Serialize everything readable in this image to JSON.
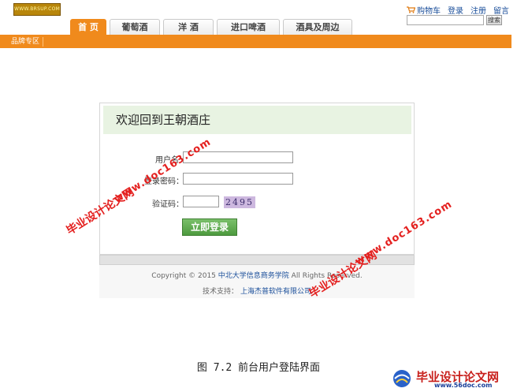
{
  "header": {
    "logo_text": "WWW.BRSUP.COM",
    "links": [
      "购物车",
      "登录",
      "注册",
      "留言"
    ],
    "search_placeholder": "",
    "search_button": "搜索"
  },
  "nav": {
    "tabs": [
      "首 页",
      "葡萄酒",
      "洋 酒",
      "进口啤酒",
      "酒具及周边"
    ],
    "active_index": 0,
    "sub_tab": "品牌专区"
  },
  "login": {
    "welcome": "欢迎回到王朝酒庄",
    "username_label": "用户名：",
    "password_label": "登录密码：",
    "captcha_label": "验证码：",
    "captcha_code": "2495",
    "submit": "立即登录"
  },
  "footer": {
    "copyright_prefix": "Copyright © 2015",
    "copyright_org": "中北大学信息商务学院",
    "copyright_suffix": "All Rights Reserved.",
    "support_label": "技术支持：",
    "support_company": "上海杰普软件有限公司"
  },
  "caption": "图 7.2  前台用户登陆界面",
  "watermark": {
    "site_cn": "毕业设计论文网",
    "site_url": "www.doc163.com",
    "brand": "毕业设计论文网",
    "brand_url": "www.56doc.com"
  },
  "colors": {
    "accent": "#f08a1c",
    "button_green": "#4d9a3e",
    "panel_header": "#e8f3e2",
    "watermark_red": "#e4201f"
  }
}
